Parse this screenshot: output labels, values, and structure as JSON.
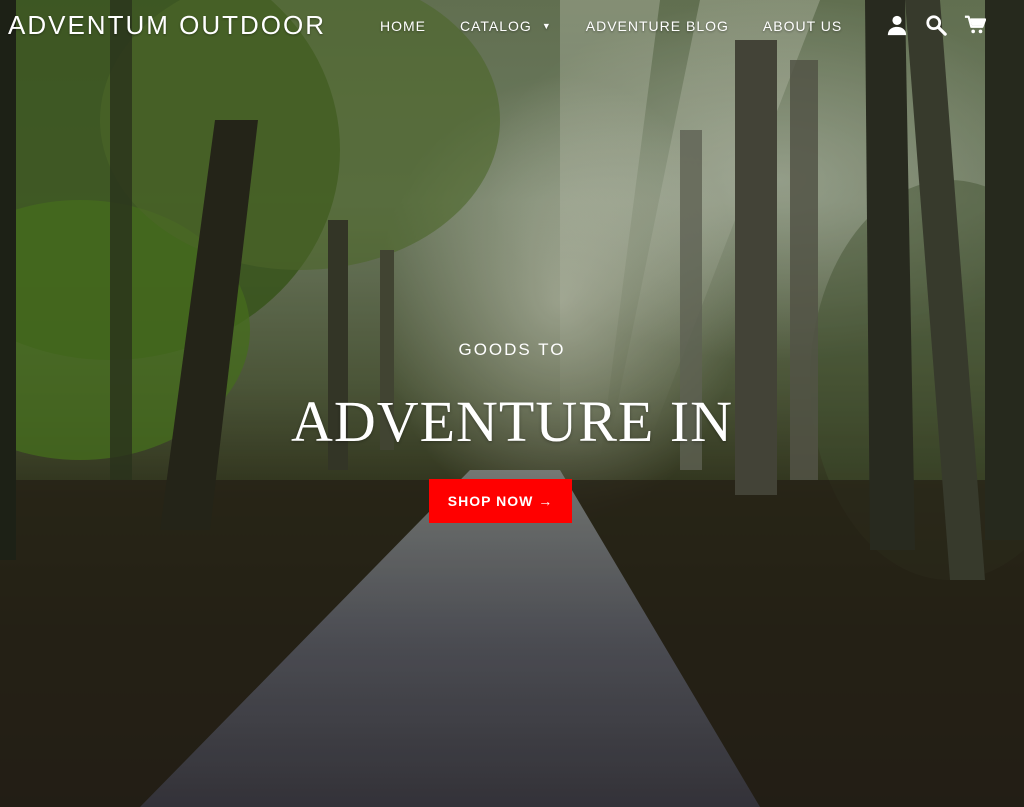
{
  "brand": {
    "logo_text": "ADVENTUM OUTDOOR"
  },
  "nav": {
    "items": [
      {
        "label": "HOME"
      },
      {
        "label": "CATALOG",
        "has_dropdown": true
      },
      {
        "label": "ADVENTURE BLOG"
      },
      {
        "label": "ABOUT US"
      }
    ]
  },
  "header_icons": [
    "account-icon",
    "search-icon",
    "cart-icon"
  ],
  "hero": {
    "eyebrow": "GOODS TO",
    "headline": "ADVENTURE IN",
    "cta_label": "SHOP NOW →"
  },
  "colors": {
    "cta_background": "#ff0000",
    "text": "#ffffff"
  }
}
